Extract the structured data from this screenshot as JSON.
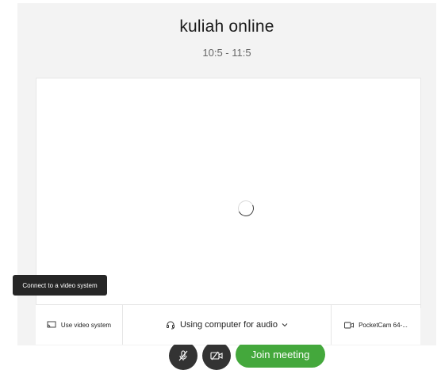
{
  "meeting": {
    "title": "kuliah online",
    "time": "10:5 - 11:5"
  },
  "controls": {
    "join_label": "Join meeting",
    "mute_icon": "microphone-muted-icon",
    "video_icon": "video-off-icon"
  },
  "tooltip": {
    "text": "Connect to a video system"
  },
  "bottom_bar": {
    "video_system_label": "Use video system",
    "audio_label": "Using computer for audio",
    "camera_label": "PocketCam 64-..."
  },
  "colors": {
    "join_button": "#44a83c",
    "control_buttons": "#333333",
    "panel_background": "#f3f3f3"
  }
}
